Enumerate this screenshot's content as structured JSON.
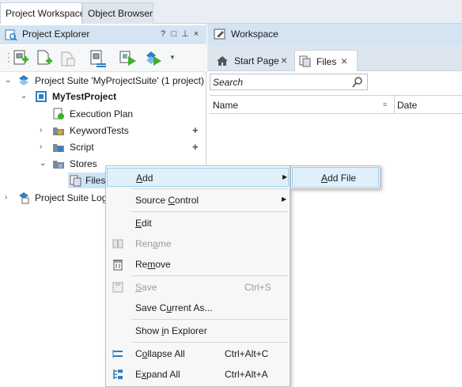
{
  "top_tabs": [
    {
      "label": "Project Workspace"
    },
    {
      "label": "Object Browser"
    }
  ],
  "explorer": {
    "title": "Project Explorer",
    "controls": [
      "?",
      "□",
      "⊥",
      "×"
    ],
    "toolbar": [
      "add-new-item",
      "add-existing-item",
      "remove",
      "project-properties",
      "run-project",
      "run-suite",
      "dropdown"
    ],
    "tree": [
      {
        "label": "Project Suite 'MyProjectSuite' (1 project)",
        "level": 0,
        "expanded": true
      },
      {
        "label": "MyTestProject",
        "level": 1,
        "expanded": true
      },
      {
        "label": "Execution Plan",
        "level": 2
      },
      {
        "label": "KeywordTests",
        "level": 2,
        "plus": "+"
      },
      {
        "label": "Script",
        "level": 2,
        "plus": "+"
      },
      {
        "label": "Stores",
        "level": 2,
        "expanded": true
      },
      {
        "label": "Files",
        "level": 3
      },
      {
        "label": "Project Suite Logs",
        "level": 0
      }
    ]
  },
  "workspace": {
    "title": "Workspace",
    "tabs": [
      {
        "label": "Start Page",
        "close": "×"
      },
      {
        "label": "Files",
        "close": "×"
      }
    ],
    "search_placeholder": "Search",
    "columns": [
      "Name",
      "Date"
    ]
  },
  "context_menu": {
    "items": [
      {
        "pre": "",
        "ul": "A",
        "post": "dd",
        "shortcut": "",
        "submenu": true,
        "highlighted": true
      },
      {
        "pre": "Source ",
        "ul": "C",
        "post": "ontrol",
        "shortcut": "",
        "submenu": true
      },
      {
        "pre": "",
        "ul": "E",
        "post": "dit",
        "shortcut": ""
      },
      {
        "pre": "Ren",
        "ul": "a",
        "post": "me",
        "shortcut": "",
        "disabled": true
      },
      {
        "pre": "Re",
        "ul": "m",
        "post": "ove",
        "shortcut": ""
      },
      {
        "pre": "",
        "ul": "S",
        "post": "ave",
        "shortcut": "Ctrl+S",
        "disabled": true
      },
      {
        "pre": "Save C",
        "ul": "u",
        "post": "rrent As...",
        "shortcut": ""
      },
      {
        "pre": "Show ",
        "ul": "i",
        "post": "n Explorer",
        "shortcut": ""
      },
      {
        "pre": "C",
        "ul": "o",
        "post": "llapse All",
        "shortcut": "Ctrl+Alt+C"
      },
      {
        "pre": "E",
        "ul": "x",
        "post": "pand All",
        "shortcut": "Ctrl+Alt+A"
      }
    ],
    "submenu": [
      {
        "pre": "",
        "ul": "A",
        "post": "dd File",
        "highlighted": true
      }
    ]
  },
  "colors": {
    "panel_header": "#d5e4f2",
    "highlight": "#dff0fb",
    "highlight_border": "#9bd0f0",
    "accent_green": "#3fae2a",
    "accent_blue": "#2f7fc1"
  }
}
